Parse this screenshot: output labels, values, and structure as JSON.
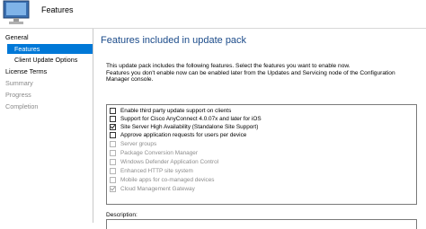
{
  "window": {
    "title": "Features",
    "icon": "computer-monitor-icon"
  },
  "nav": {
    "items": [
      {
        "label": "General",
        "state": "normal"
      },
      {
        "label": "Features",
        "state": "selected"
      },
      {
        "label": "Client Update Options",
        "state": "normal"
      },
      {
        "label": "License Terms",
        "state": "normal"
      },
      {
        "label": "Summary",
        "state": "muted"
      },
      {
        "label": "Progress",
        "state": "muted"
      },
      {
        "label": "Completion",
        "state": "muted"
      }
    ]
  },
  "main": {
    "title": "Features included in update pack",
    "intro_line1": "This update pack includes the following features. Select the features you want to enable now.",
    "intro_line2": "Features you don't enable now can be enabled later from the Updates and Servicing node of the Configuration",
    "intro_line3": "Manager console.",
    "features": [
      {
        "label": "Enable third party update support on clients",
        "checked": false,
        "disabled": false
      },
      {
        "label": "Support for Cisco AnyConnect 4.0.07x and later for iOS",
        "checked": false,
        "disabled": false
      },
      {
        "label": "Site Server High Availability (Standalone Site Support)",
        "checked": true,
        "disabled": false
      },
      {
        "label": "Approve application requests for users per device",
        "checked": false,
        "disabled": false
      },
      {
        "label": "Server groups",
        "checked": false,
        "disabled": true
      },
      {
        "label": "Package Conversion Manager",
        "checked": false,
        "disabled": true
      },
      {
        "label": "Windows Defender Application Control",
        "checked": false,
        "disabled": true
      },
      {
        "label": "Enhanced HTTP site system",
        "checked": false,
        "disabled": true
      },
      {
        "label": "Mobile apps for co-managed devices",
        "checked": false,
        "disabled": true
      },
      {
        "label": "Cloud Management Gateway",
        "checked": true,
        "disabled": true
      }
    ],
    "description_label": "Description:"
  }
}
